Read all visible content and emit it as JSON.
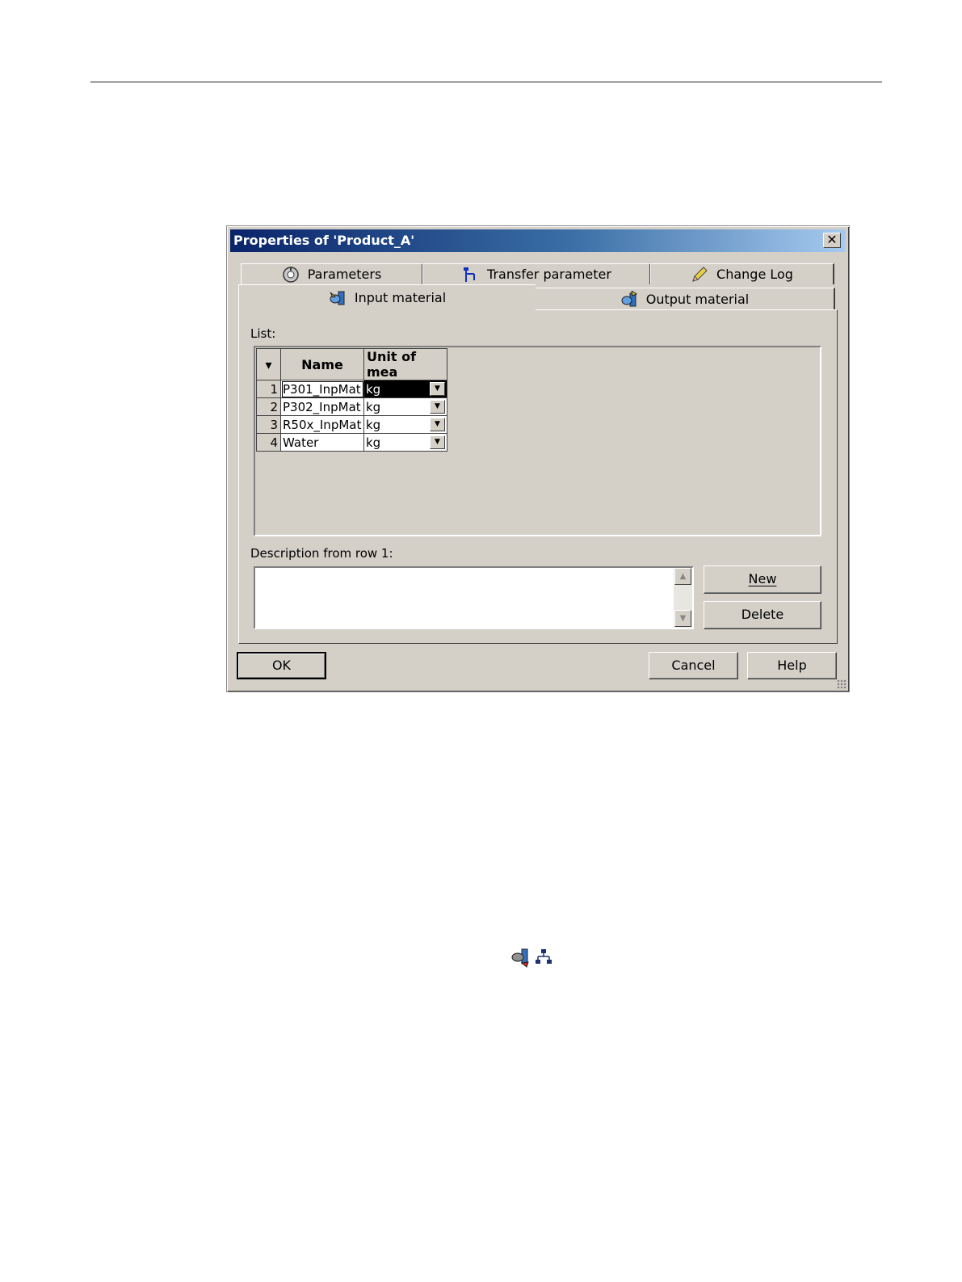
{
  "dialog": {
    "title": "Properties of 'Product_A'",
    "close_glyph": "✕"
  },
  "tabs": {
    "row1": [
      {
        "label": "Parameters",
        "icon": "parameters-icon"
      },
      {
        "label": "Transfer parameter",
        "icon": "transfer-parameter-icon"
      },
      {
        "label": "Change Log",
        "icon": "pencil-icon"
      }
    ],
    "row2": [
      {
        "label": "Input material",
        "icon": "input-material-icon",
        "active": true
      },
      {
        "label": "Output material",
        "icon": "output-material-icon",
        "active": false
      }
    ]
  },
  "list": {
    "label": "List:",
    "header_sort": "▾",
    "columns": [
      "Name",
      "Unit of mea"
    ],
    "rows": [
      {
        "num": "1",
        "name": "P301_InpMat",
        "unit": "kg",
        "selected": true
      },
      {
        "num": "2",
        "name": "P302_InpMat",
        "unit": "kg",
        "selected": false
      },
      {
        "num": "3",
        "name": "R50x_InpMat",
        "unit": "kg",
        "selected": false
      },
      {
        "num": "4",
        "name": "Water",
        "unit": "kg",
        "selected": false
      }
    ]
  },
  "description": {
    "label": "Description from row 1:",
    "value": ""
  },
  "buttons": {
    "new": "New",
    "delete": "Delete",
    "ok": "OK",
    "cancel": "Cancel",
    "help": "Help"
  },
  "colors": {
    "dialog_bg": "#d4d0c8",
    "title_gradient_start": "#0a246a",
    "title_gradient_end": "#a6caf0"
  },
  "below_dialog_icons": [
    "material-icon",
    "network-icon"
  ]
}
